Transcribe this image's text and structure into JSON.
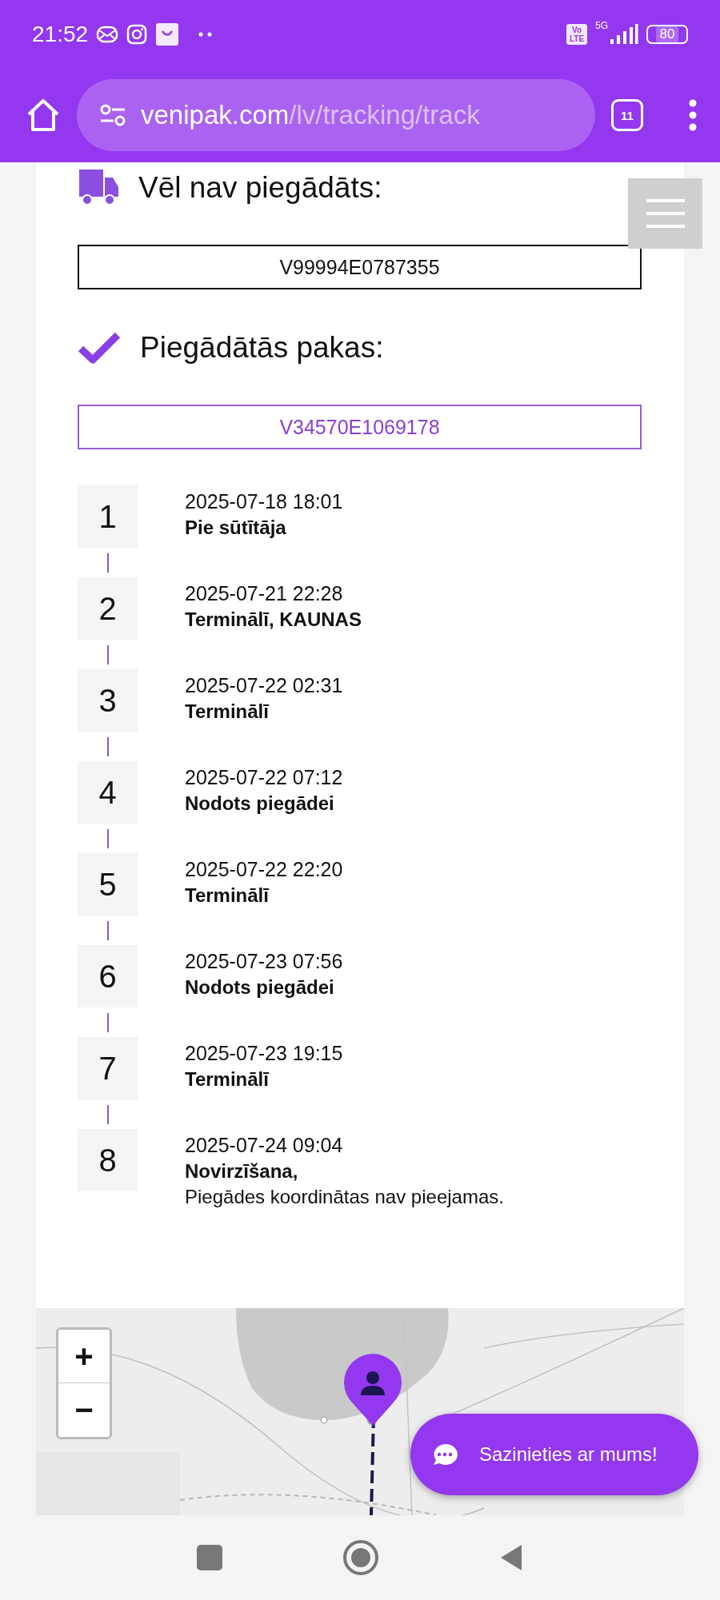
{
  "status_bar": {
    "time": "21:52",
    "volte": "Vo LTE",
    "network": "5G",
    "battery": "80"
  },
  "browser": {
    "url_domain": "venipak.com",
    "url_path": "/lv/tracking/track",
    "tab_count": "11"
  },
  "pending": {
    "title": "Vēl nav piegādāts:",
    "parcels": [
      "V99994E0787355"
    ]
  },
  "delivered": {
    "title": "Piegādātās pakas:",
    "parcels": [
      "V34570E1069178"
    ]
  },
  "timeline": [
    {
      "number": "1",
      "date": "2025-07-18 18:01",
      "status": "Pie sūtītāja"
    },
    {
      "number": "2",
      "date": "2025-07-21 22:28",
      "status": "Terminālī, KAUNAS"
    },
    {
      "number": "3",
      "date": "2025-07-22 02:31",
      "status": "Terminālī"
    },
    {
      "number": "4",
      "date": "2025-07-22 07:12",
      "status": "Nodots piegādei"
    },
    {
      "number": "5",
      "date": "2025-07-22 22:20",
      "status": "Terminālī"
    },
    {
      "number": "6",
      "date": "2025-07-23 07:56",
      "status": "Nodots piegādei"
    },
    {
      "number": "7",
      "date": "2025-07-23 19:15",
      "status": "Terminālī"
    },
    {
      "number": "8",
      "date": "2025-07-24 09:04",
      "status": "Novirzīšana,",
      "detail": "Piegādes koordinātas nav pieejamas."
    }
  ],
  "map": {
    "kind": "picture",
    "zoom_in": "+",
    "zoom_out": "−"
  },
  "chat_button": {
    "label": "Sazinieties ar mums!"
  }
}
